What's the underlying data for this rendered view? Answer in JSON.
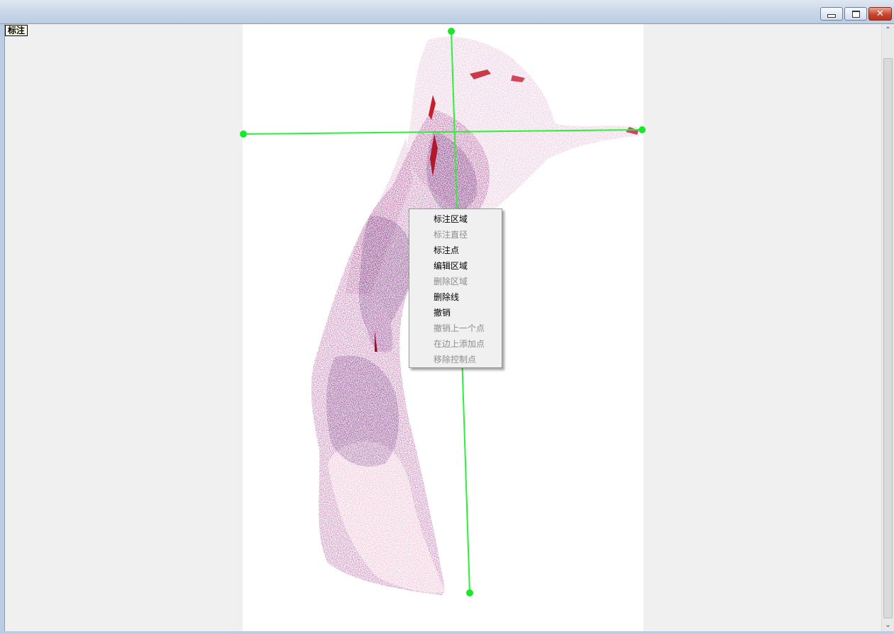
{
  "window": {
    "title": "",
    "controls": {
      "minimize_icon": "minimize-icon",
      "maximize_icon": "restore-icon",
      "close_icon": "close-icon",
      "close_glyph": "✕"
    }
  },
  "toolbar": {
    "annotate_label": "标注"
  },
  "annotation": {
    "line_color": "#2cf03a",
    "handle_color": "#17e82a"
  },
  "context_menu": {
    "items": [
      {
        "label": "标注区域",
        "enabled": true
      },
      {
        "label": "标注直径",
        "enabled": false
      },
      {
        "label": "标注点",
        "enabled": true
      },
      {
        "label": "编辑区域",
        "enabled": true
      },
      {
        "label": "删除区域",
        "enabled": false
      },
      {
        "label": "删除线",
        "enabled": true
      },
      {
        "label": "撤销",
        "enabled": true
      },
      {
        "label": "撤销上一个点",
        "enabled": false
      },
      {
        "label": "在边上添加点",
        "enabled": false
      },
      {
        "label": "移除控制点",
        "enabled": false
      }
    ]
  },
  "scrollbar": {
    "up_icon": "chevron-up-icon",
    "down_icon": "chevron-down-icon",
    "up_glyph": "⌃",
    "down_glyph": "⌄"
  }
}
